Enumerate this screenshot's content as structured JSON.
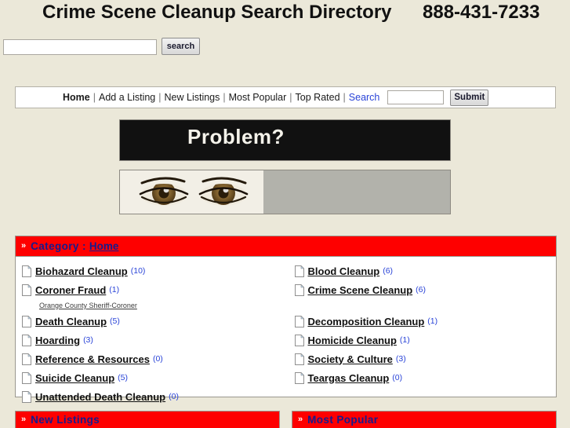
{
  "header": {
    "title": "Crime Scene Cleanup Search Directory",
    "phone": "888-431-7233"
  },
  "top_search": {
    "value": "",
    "placeholder": "",
    "button_label": "search"
  },
  "nav": {
    "home_label": "Home",
    "separator": "|",
    "items": [
      {
        "label": "Add a Listing",
        "style": "plain"
      },
      {
        "label": "New Listings",
        "style": "plain"
      },
      {
        "label": "Most Popular",
        "style": "plain"
      },
      {
        "label": "Top Rated",
        "style": "plain"
      },
      {
        "label": "Search",
        "style": "link"
      }
    ],
    "search_value": "",
    "submit_label": "Submit"
  },
  "banner": {
    "text": "Problem?"
  },
  "eyes": {
    "alt": "eyes-image"
  },
  "category_panel": {
    "arrow": "»",
    "label": "Category :",
    "current": "Home",
    "left_column": [
      {
        "type": "category",
        "name": "Biohazard Cleanup",
        "count": "(10)"
      },
      {
        "type": "category",
        "name": "Coroner Fraud",
        "count": "(1)"
      },
      {
        "type": "subitem",
        "name": "Orange County Sheriff-Coroner"
      },
      {
        "type": "category",
        "name": "Death Cleanup",
        "count": "(5)"
      },
      {
        "type": "category",
        "name": "Hoarding",
        "count": "(3)"
      },
      {
        "type": "category",
        "name": "Reference & Resources",
        "count": "(0)"
      },
      {
        "type": "category",
        "name": "Suicide Cleanup",
        "count": "(5)"
      },
      {
        "type": "category",
        "name": "Unattended Death Cleanup",
        "count": "(0)"
      }
    ],
    "right_column": [
      {
        "type": "category",
        "name": "Blood Cleanup",
        "count": "(6)"
      },
      {
        "type": "category",
        "name": "Crime Scene Cleanup",
        "count": "(6)"
      },
      {
        "type": "spacer"
      },
      {
        "type": "category",
        "name": "Decomposition Cleanup",
        "count": "(1)"
      },
      {
        "type": "category",
        "name": "Homicide Cleanup",
        "count": "(1)"
      },
      {
        "type": "category",
        "name": "Society & Culture",
        "count": "(3)"
      },
      {
        "type": "category",
        "name": "Teargas Cleanup",
        "count": "(0)"
      }
    ]
  },
  "bottom": {
    "arrow": "»",
    "new_listings": "New Listings",
    "most_popular": "Most Popular"
  },
  "colors": {
    "page_background": "#ebe8d9",
    "accent_red": "#fe0000",
    "heading_blue": "#151b8d",
    "link_blue": "#2a44d8",
    "banner_black": "#111111"
  }
}
